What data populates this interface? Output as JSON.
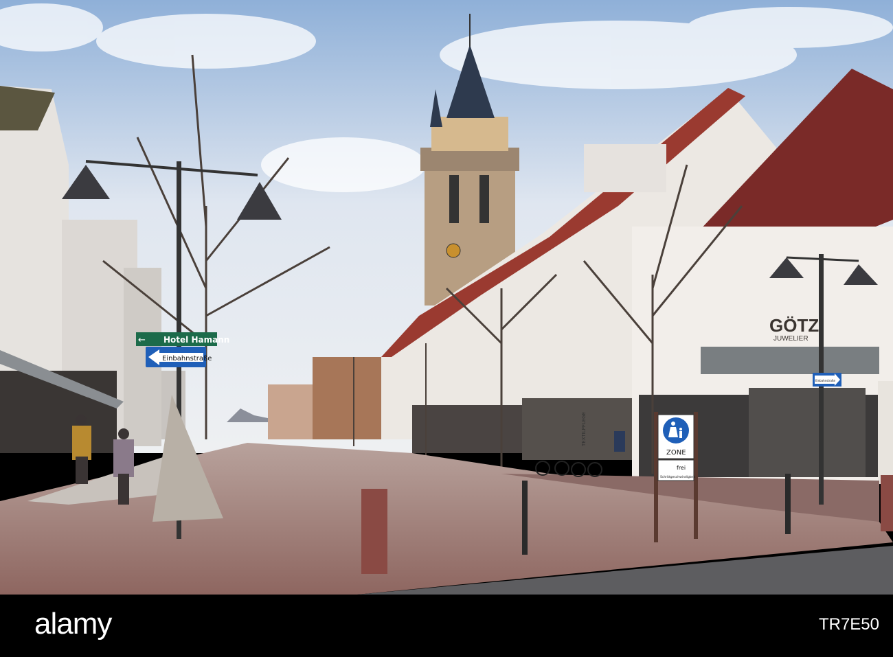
{
  "photo": {
    "signs": {
      "hotel": "Hotel Hamann",
      "one_way_left": "Einbahnstraße",
      "one_way_right": "Einbahnstraße",
      "zone": "ZONE",
      "zone_sub_top": "frei",
      "zone_sub_bottom": "Schrittgeschwindigkeit"
    },
    "shop": {
      "name": "GÖTZ",
      "type": "JUWELIER",
      "textile": "TEXTILPFLEGE"
    }
  },
  "watermark": {
    "brand": "alamy",
    "image_code": "TR7E50"
  }
}
